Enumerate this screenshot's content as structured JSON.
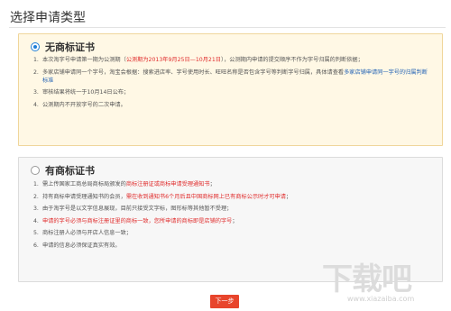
{
  "page": {
    "title": "选择申请类型"
  },
  "option_a": {
    "label": "无商标证书",
    "selected": true,
    "items": [
      {
        "num": "1.",
        "parts": [
          {
            "t": "本次淘字号申请第一期为公测期（"
          },
          {
            "t": "公测期为2013年9月25日—10月21日",
            "c": "red"
          },
          {
            "t": "），公测期内申请的提交顺序不作为字号归属的判断依据；"
          }
        ]
      },
      {
        "num": "2.",
        "parts": [
          {
            "t": "多家店铺申请同一个字号，淘宝会根据：搜索进店率、字号使用时长、旺旺名称是否包含字号等判断字号归属，具体请查看"
          },
          {
            "t": "多家店铺申请同一字号的归属判断标准",
            "c": "blue"
          }
        ]
      },
      {
        "num": "3.",
        "parts": [
          {
            "t": "审核结果将统一于10月14日公布；"
          }
        ]
      },
      {
        "num": "4.",
        "parts": [
          {
            "t": "公测期内不开放字号的二次申请。"
          }
        ]
      }
    ]
  },
  "option_b": {
    "label": "有商标证书",
    "selected": false,
    "items": [
      {
        "num": "1.",
        "parts": [
          {
            "t": "需上传国家工商总局商标局颁发的"
          },
          {
            "t": "商标注册证或商标申请受理通知书",
            "c": "red"
          },
          {
            "t": "；"
          }
        ]
      },
      {
        "num": "2.",
        "parts": [
          {
            "t": "持有商标申请受理通知书的会员，"
          },
          {
            "t": "需在收到通知书6个月后且中国商标网上已有商标公示时才可申请",
            "c": "red"
          },
          {
            "t": "；"
          }
        ]
      },
      {
        "num": "3.",
        "parts": [
          {
            "t": "由于淘字号是以文字信息展现，目前只接受文字标，图形标等其他暂不受理；"
          }
        ]
      },
      {
        "num": "4.",
        "parts": [
          {
            "t": "申请的字号必须与商标注册证里的商标一致，",
            "c": "red"
          },
          {
            "t": "您所申请的商标即是店铺的字号",
            "c": "red"
          },
          {
            "t": "；"
          }
        ]
      },
      {
        "num": "5.",
        "parts": [
          {
            "t": "商标注册人必须与开店人信息一致；"
          }
        ]
      },
      {
        "num": "6.",
        "parts": [
          {
            "t": "申请的信息必须保证真实有效。"
          }
        ]
      }
    ]
  },
  "footer": {
    "next_label": "下一步"
  },
  "watermark": {
    "logo_text": "下载吧",
    "url": "www.xiazaiba.com"
  },
  "colors": {
    "accent": "#e8452c",
    "link": "#2463b5",
    "warn": "#e02d2d",
    "radio": "#1e7fd8"
  }
}
